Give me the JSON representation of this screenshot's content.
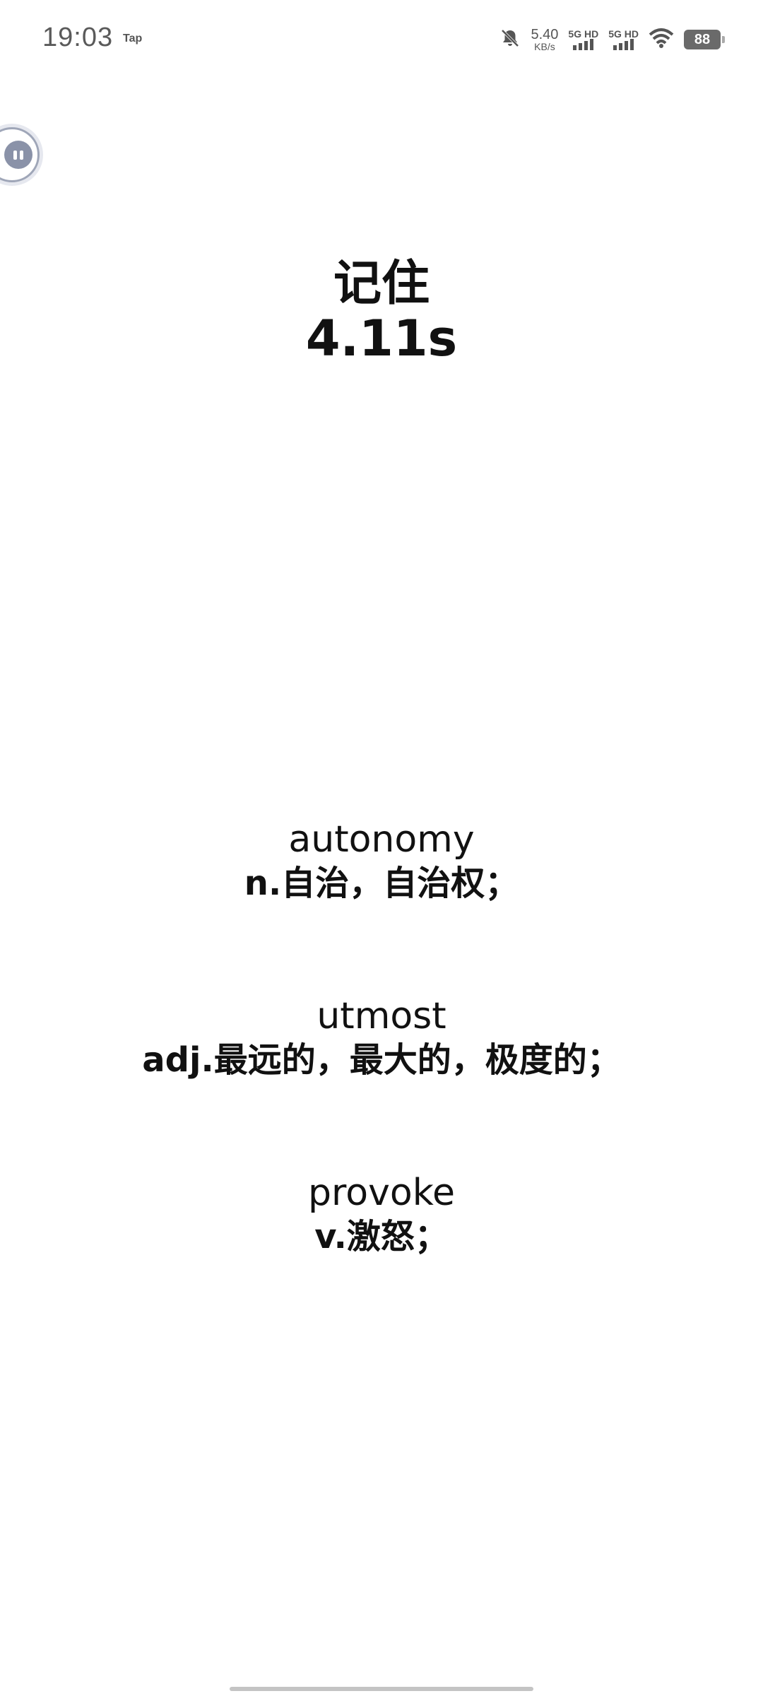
{
  "status_bar": {
    "time": "19:03",
    "app_tag": "Tap",
    "net_speed_value": "5.40",
    "net_speed_unit": "KB/s",
    "sim1_label": "5G HD",
    "sim2_label": "5G HD",
    "battery": "88",
    "icons": [
      "bell-muted-icon",
      "signal-icon",
      "signal-icon",
      "wifi-icon",
      "battery-icon"
    ]
  },
  "header": {
    "title": "记住",
    "timer": "4.11s"
  },
  "words": [
    {
      "word": "autonomy",
      "definition": "n.自治，自治权；"
    },
    {
      "word": "utmost",
      "definition": "adj.最远的，最大的，极度的；"
    },
    {
      "word": "provoke",
      "definition": "v.激怒；"
    }
  ],
  "colors": {
    "background": "#ffffff",
    "text": "#111111",
    "status_text": "#5a5a5a",
    "float_button": "#8a92a8"
  }
}
